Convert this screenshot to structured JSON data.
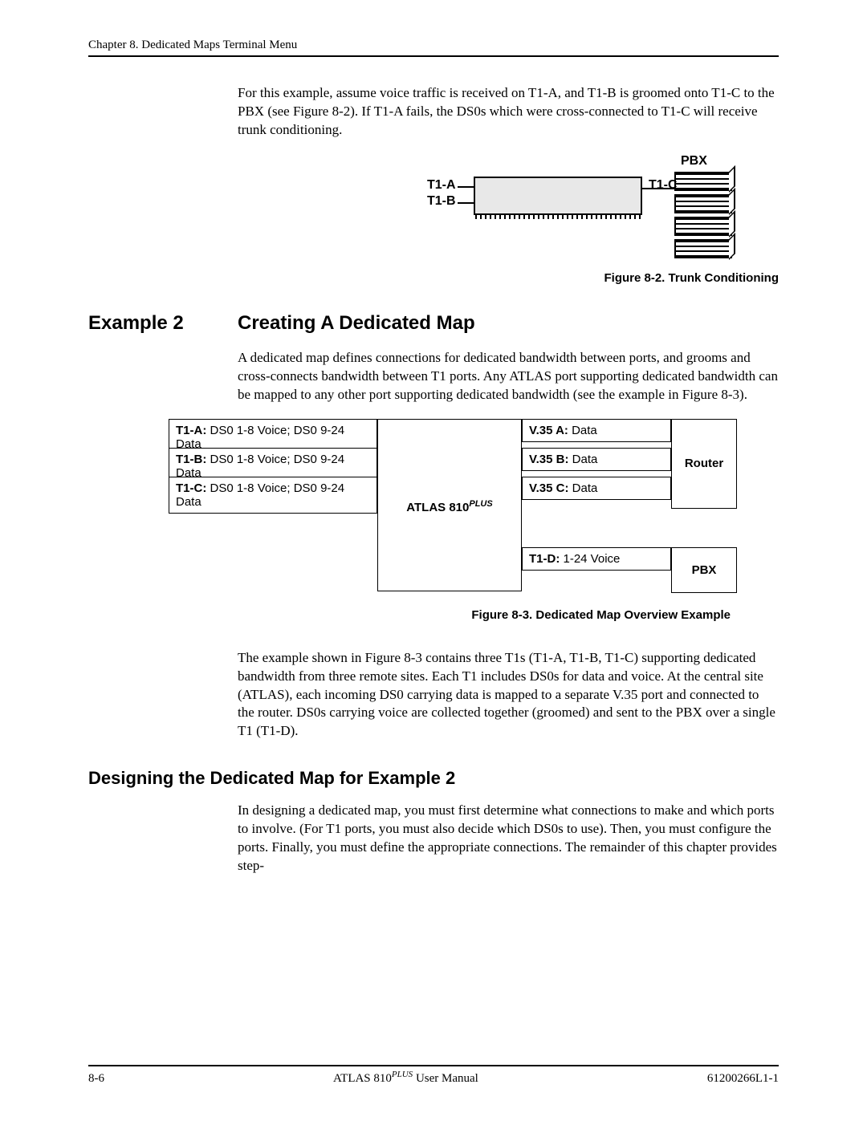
{
  "header": {
    "chapter_line": "Chapter 8.  Dedicated Maps Terminal Menu"
  },
  "intro_para": "For this example, assume voice traffic is received on T1-A, and T1-B is groomed onto T1-C to the PBX (see Figure 8-2). If T1-A fails, the DS0s which were cross-connected to T1-C will receive trunk conditioning.",
  "fig82": {
    "label_pbx": "PBX",
    "label_t1a": "T1-A",
    "label_t1b": "T1-B",
    "label_t1c": "T1-C",
    "caption": "Figure 8-2.  Trunk Conditioning"
  },
  "ex2": {
    "left": "Example 2",
    "right": "Creating A Dedicated Map",
    "para": "A dedicated map defines connections for dedicated bandwidth between ports, and grooms and cross-connects bandwidth between T1 ports. Any ATLAS port supporting dedicated bandwidth can be mapped to any other port supporting dedicated bandwidth (see the example in Figure 8-3)."
  },
  "fig83": {
    "left_rows": [
      {
        "b": "T1-A:",
        "t": " DS0 1-8 Voice; DS0 9-24 Data"
      },
      {
        "b": "T1-B:",
        "t": " DS0 1-8 Voice; DS0 9-24 Data"
      },
      {
        "b": "T1-C:",
        "t": " DS0 1-8 Voice; DS0 9-24 Data"
      }
    ],
    "center_label_a": "ATLAS 810",
    "center_label_b": "PLUS",
    "right_rows": [
      {
        "b": "V.35 A:",
        "t": " Data"
      },
      {
        "b": "V.35 B:",
        "t": " Data"
      },
      {
        "b": "V.35 C:",
        "t": " Data"
      }
    ],
    "t1d": {
      "b": "T1-D:",
      "t": " 1-24 Voice"
    },
    "router": "Router",
    "pbx": "PBX",
    "caption": "Figure 8-3.  Dedicated Map Overview Example"
  },
  "ex2_after": "The example shown in Figure 8-3 contains three T1s (T1-A, T1-B, T1-C) supporting dedicated bandwidth from three remote sites. Each T1 includes DS0s for data and voice. At the central site (ATLAS), each incoming DS0 carrying data is mapped to a separate V.35 port and connected to the router. DS0s carrying voice are collected together (groomed) and sent to the PBX over a single T1 (T1-D).",
  "design": {
    "heading": "Designing the Dedicated Map for Example 2",
    "para": "In designing a dedicated map, you must first determine what connections to make and which ports to involve. (For T1 ports, you must also decide which DS0s to use). Then, you must configure the ports. Finally, you must define the appropriate connections. The remainder of this chapter provides step-"
  },
  "footer": {
    "page": "8-6",
    "center_a": "ATLAS 810",
    "center_b": "PLUS",
    "center_c": " User Manual",
    "right": "61200266L1-1"
  }
}
